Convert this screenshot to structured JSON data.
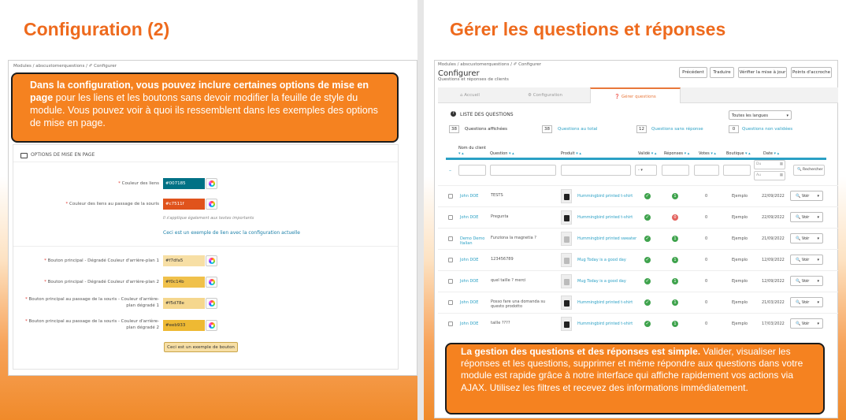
{
  "left": {
    "title": "Configuration (2)",
    "breadcrumb": "Modules  /  abscustomerquestions  /  ✐ Configurer",
    "callout": {
      "bold": "Dans la configuration, vous pouvez inclure certaines options de mise en page",
      "rest": " pour les liens et les boutons sans devoir modifier la feuille de style du module. Vous pouvez voir à quoi ils ressemblent dans les exemples des options de mise en page."
    },
    "card_title": "OPTIONS DE MISE EN PAGE",
    "fields": [
      {
        "label": "Couleur des liens",
        "value": "#007185",
        "color": "#007185",
        "text_color": "#ffffff"
      },
      {
        "label": "Couleur des liens au passage de la souris",
        "value": "#c7511f",
        "color": "#e0531c",
        "text_color": "#ffffff"
      },
      {
        "label": "Bouton principal - Dégradé Couleur d'arrière-plan 1",
        "value": "#f7dfa5",
        "color": "#f7dfa5",
        "text_color": "#333333"
      },
      {
        "label": "Bouton principal - Dégradé Couleur d'arrière-plan 2",
        "value": "#f0c14b",
        "color": "#f0c14b",
        "text_color": "#333333"
      },
      {
        "label": "Bouton principal au passage de la souris - Couleur d'arrière-plan dégradé 1",
        "value": "#f5d78e",
        "color": "#f5d78e",
        "text_color": "#333333"
      },
      {
        "label": "Bouton principal au passage de la souris - Couleur d'arrière-plan dégradé 2",
        "value": "#eeb933",
        "color": "#eeb933",
        "text_color": "#333333"
      }
    ],
    "hover_note": "Il s'applique également aux textes importants",
    "example_link": "Ceci est un exemple de lien avec la configuration actuelle",
    "example_button": "Ceci est un exemple de bouton"
  },
  "right": {
    "title": "Gérer les questions et réponses",
    "breadcrumb": "Modules  /  abscustomerquestions  /  ✐ Configurer",
    "page_title": "Configurer",
    "page_subtitle": "Questions et réponses de clients",
    "top_buttons": [
      "Précédent",
      "Traduire",
      "Vérifier la mise à jour",
      "Points d'accroche"
    ],
    "tabs": [
      "Accueil",
      "Configuration",
      "Gérer questions"
    ],
    "list_title": "LISTE DES QUESTIONS",
    "language_select": "Toutes les langues",
    "stats": [
      {
        "num": "38",
        "label": "Questions affichées",
        "accent": false
      },
      {
        "num": "38",
        "label": "Questions au total",
        "accent": true
      },
      {
        "num": "12",
        "label": "Questions sans réponse",
        "accent": true
      },
      {
        "num": "0",
        "label": "Questions non validées",
        "accent": true
      }
    ],
    "columns": [
      "Nom du client",
      "Question",
      "Produit",
      "Validé",
      "Réponses",
      "Votes",
      "Boutique",
      "Date"
    ],
    "search_button": "Rechercher",
    "view_label": "Voir",
    "date_from": "Du",
    "date_to": "Au",
    "rows": [
      {
        "client": "John DOE",
        "question": "TESTS",
        "product": "Hummingbird printed t-shirt",
        "responses": "1",
        "resp_color": "#3fa34d",
        "votes": "0",
        "shop": "Ejemplo",
        "date": "22/09/2022",
        "dark": true
      },
      {
        "client": "John DOE",
        "question": "Pregunta",
        "product": "Hummingbird printed t-shirt",
        "responses": "0",
        "resp_color": "#e3635e",
        "votes": "0",
        "shop": "Ejemplo",
        "date": "22/09/2022",
        "dark": true
      },
      {
        "client": "Demo Demo Italian",
        "question": "Funziona la magnetia ?",
        "product": "Hummingbird printed sweater",
        "responses": "1",
        "resp_color": "#3fa34d",
        "votes": "0",
        "shop": "Ejemplo",
        "date": "21/09/2022",
        "dark": false
      },
      {
        "client": "John DOE",
        "question": "123456789",
        "product": "Mug Today is a good day",
        "responses": "1",
        "resp_color": "#3fa34d",
        "votes": "0",
        "shop": "Ejemplo",
        "date": "12/09/2022",
        "dark": false
      },
      {
        "client": "John DOE",
        "question": "quel taille ? merci",
        "product": "Mug Today is a good day",
        "responses": "1",
        "resp_color": "#3fa34d",
        "votes": "0",
        "shop": "Ejemplo",
        "date": "12/09/2022",
        "dark": false
      },
      {
        "client": "John DOE",
        "question": "Posso fare una domanda su questo prodotto",
        "product": "Hummingbird printed t-shirt",
        "responses": "1",
        "resp_color": "#3fa34d",
        "votes": "0",
        "shop": "Ejemplo",
        "date": "21/03/2022",
        "dark": true
      },
      {
        "client": "John DOE",
        "question": "taille ????",
        "product": "Hummingbird printed t-shirt",
        "responses": "1",
        "resp_color": "#3fa34d",
        "votes": "0",
        "shop": "Ejemplo",
        "date": "17/03/2022",
        "dark": true
      }
    ],
    "callout": {
      "bold": "La gestion des questions et des réponses est simple.",
      "rest": " Valider, visualiser les réponses et les questions, supprimer et même répondre aux questions dans votre module est rapide grâce à notre interface qui affiche rapidement vos actions via AJAX. Utilisez les filtres et recevez des informations immédiatement."
    }
  }
}
